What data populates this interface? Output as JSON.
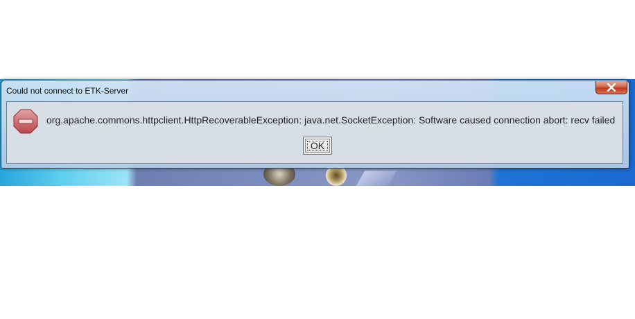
{
  "dialog": {
    "title": "Could not connect to ETK-Server",
    "message": "org.apache.commons.httpclient.HttpRecoverableException: java.net.SocketException: Software caused connection abort: recv failed",
    "ok_label": "OK",
    "icon": "stop-sign-icon",
    "close_icon": "close-icon"
  },
  "colors": {
    "title_bar": "#c8dcf0",
    "client_bg": "#d8dee5",
    "close_button": "#c0391e",
    "stop_icon": "#c0585c"
  }
}
